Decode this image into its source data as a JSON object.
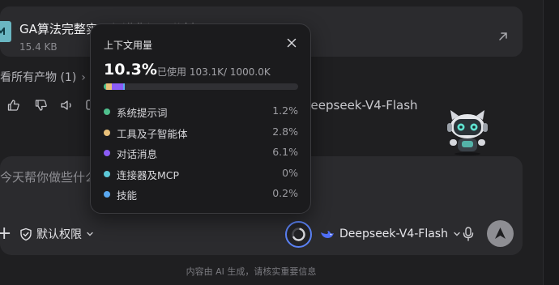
{
  "file": {
    "name": "GA算法完整实现与进化闭环分析.md",
    "size": "15.4 KB"
  },
  "products": {
    "label": "看所有产物 (1)"
  },
  "response": {
    "model": "Deepseek-V4-Flash"
  },
  "composer": {
    "placeholder": "今天帮你做些什么?",
    "permissions_label": "默认权限",
    "model_label": "Deepseek-V4-Flash"
  },
  "footer": {
    "disclaimer": "内容由 AI 生成，请核实重要信息"
  },
  "context_popover": {
    "title": "上下文用量",
    "percent": "10.3%",
    "used_text": "已使用 103.1K/ 1000.0K",
    "used_fraction": 0.103,
    "items": [
      {
        "label": "系统提示词",
        "value": "1.2%",
        "fraction": 0.012,
        "color": "#4fc08d"
      },
      {
        "label": "工具及子智能体",
        "value": "2.8%",
        "fraction": 0.028,
        "color": "#e8c07a"
      },
      {
        "label": "对话消息",
        "value": "6.1%",
        "fraction": 0.061,
        "color": "#8b5cf6"
      },
      {
        "label": "连接器及MCP",
        "value": "0%",
        "fraction": 0.0,
        "color": "#5cc8d7"
      },
      {
        "label": "技能",
        "value": "0.2%",
        "fraction": 0.002,
        "color": "#5aa8f0"
      }
    ]
  },
  "colors": {
    "accent": "#5b82f5",
    "surface": "#2b2b2e",
    "background": "#1f1f21"
  },
  "icons": [
    "file-icon",
    "open-external-icon",
    "chevron-right-icon",
    "like-icon",
    "dislike-icon",
    "speaker-icon",
    "copy-icon",
    "robot-mascot",
    "plus-icon",
    "shield-check-icon",
    "chevron-down-icon",
    "context-ring-icon",
    "whale-icon",
    "microphone-icon",
    "send-arrow-icon",
    "close-icon"
  ]
}
